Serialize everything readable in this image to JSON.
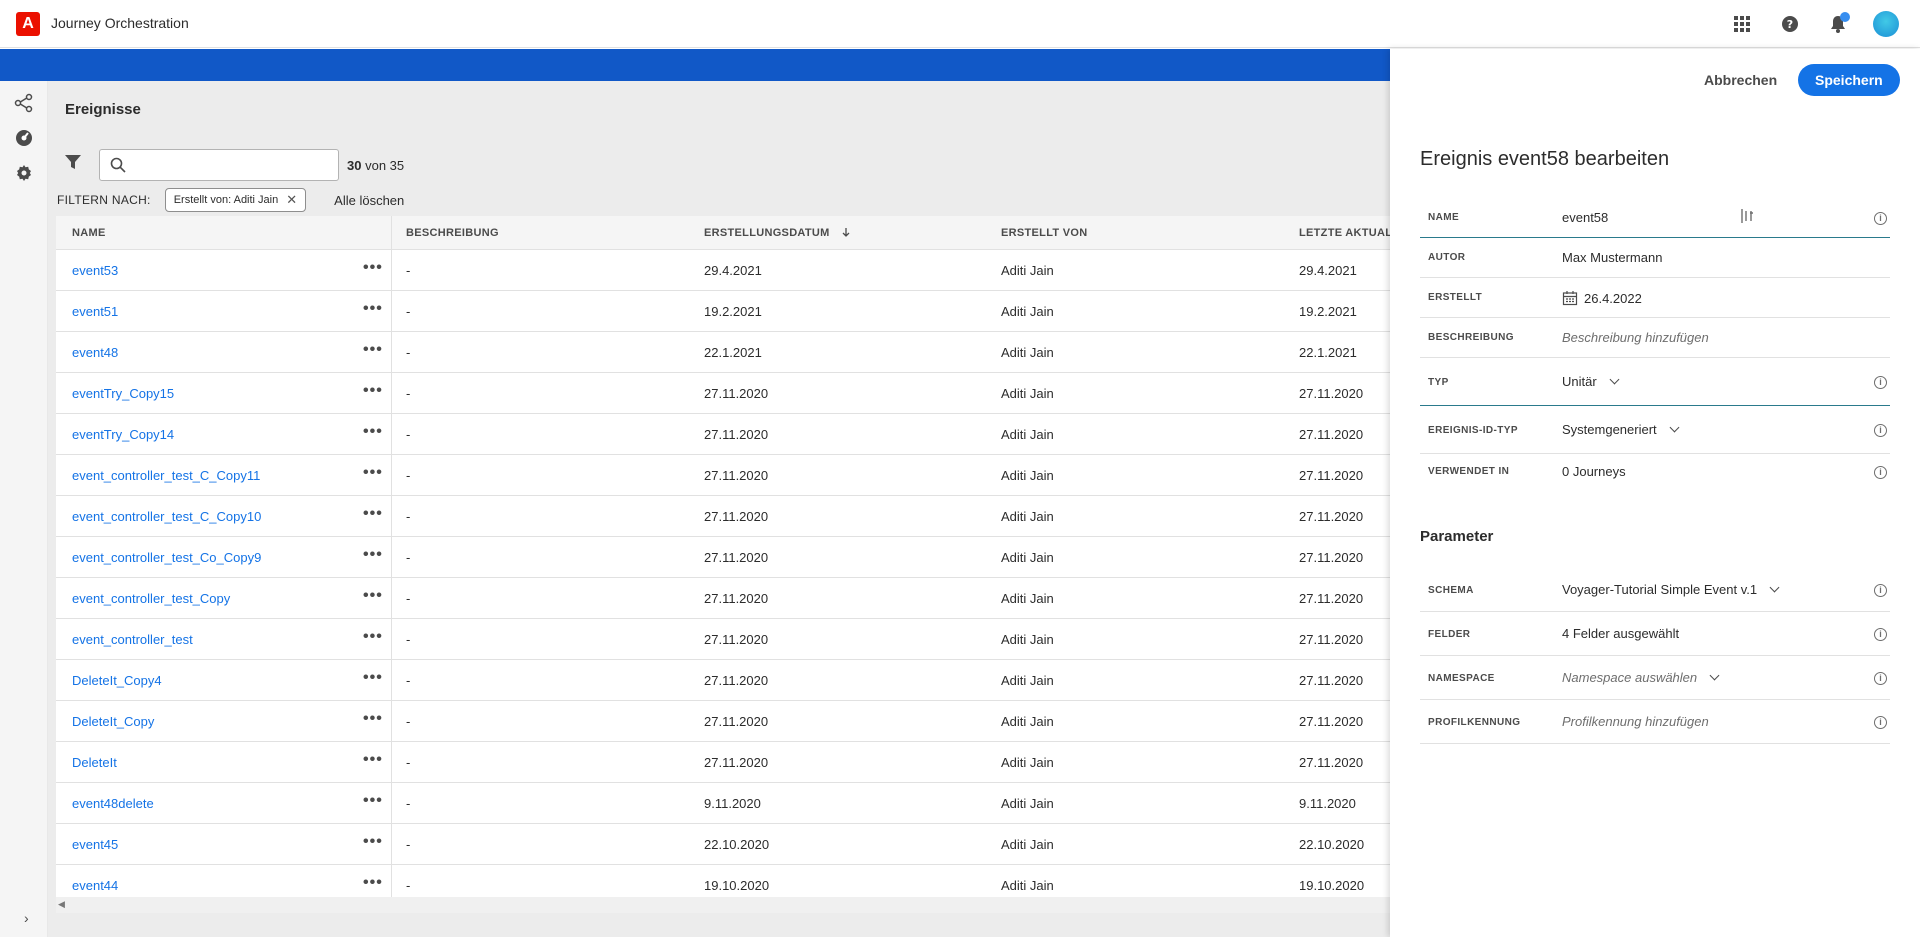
{
  "app": {
    "logo_text": "A",
    "title": "Journey Orchestration"
  },
  "header_icons": [
    "apps-grid-icon",
    "help-icon",
    "notification-bell-icon",
    "user-avatar"
  ],
  "colors": {
    "accent": "#1473e6",
    "band": "#1158c7",
    "brand": "#eb1000"
  },
  "page": {
    "title": "Ereignisse",
    "search": {
      "value": "",
      "placeholder": ""
    },
    "count_shown": "30",
    "count_suffix": "von 35",
    "filter_label": "FILTERN NACH:",
    "filter_chip": "Erstellt von: Aditi Jain",
    "clear_all": "Alle löschen"
  },
  "table": {
    "headers": {
      "name": "NAME",
      "desc": "BESCHREIBUNG",
      "created": "ERSTELLUNGSDATUM",
      "author": "ERSTELLT VON",
      "updated": "LETZTE AKTUALIS"
    },
    "rows": [
      {
        "name": "event53",
        "desc": "-",
        "created": "29.4.2021",
        "author": "Aditi Jain",
        "updated": "29.4.2021"
      },
      {
        "name": "event51",
        "desc": "-",
        "created": "19.2.2021",
        "author": "Aditi Jain",
        "updated": "19.2.2021"
      },
      {
        "name": "event48",
        "desc": "-",
        "created": "22.1.2021",
        "author": "Aditi Jain",
        "updated": "22.1.2021"
      },
      {
        "name": "eventTry_Copy15",
        "desc": "-",
        "created": "27.11.2020",
        "author": "Aditi Jain",
        "updated": "27.11.2020"
      },
      {
        "name": "eventTry_Copy14",
        "desc": "-",
        "created": "27.11.2020",
        "author": "Aditi Jain",
        "updated": "27.11.2020"
      },
      {
        "name": "event_controller_test_C_Copy11",
        "desc": "-",
        "created": "27.11.2020",
        "author": "Aditi Jain",
        "updated": "27.11.2020"
      },
      {
        "name": "event_controller_test_C_Copy10",
        "desc": "-",
        "created": "27.11.2020",
        "author": "Aditi Jain",
        "updated": "27.11.2020"
      },
      {
        "name": "event_controller_test_Co_Copy9",
        "desc": "-",
        "created": "27.11.2020",
        "author": "Aditi Jain",
        "updated": "27.11.2020"
      },
      {
        "name": "event_controller_test_Copy",
        "desc": "-",
        "created": "27.11.2020",
        "author": "Aditi Jain",
        "updated": "27.11.2020"
      },
      {
        "name": "event_controller_test",
        "desc": "-",
        "created": "27.11.2020",
        "author": "Aditi Jain",
        "updated": "27.11.2020"
      },
      {
        "name": "DeleteIt_Copy4",
        "desc": "-",
        "created": "27.11.2020",
        "author": "Aditi Jain",
        "updated": "27.11.2020"
      },
      {
        "name": "DeleteIt_Copy",
        "desc": "-",
        "created": "27.11.2020",
        "author": "Aditi Jain",
        "updated": "27.11.2020"
      },
      {
        "name": "DeleteIt",
        "desc": "-",
        "created": "27.11.2020",
        "author": "Aditi Jain",
        "updated": "27.11.2020"
      },
      {
        "name": "event48delete",
        "desc": "-",
        "created": "9.11.2020",
        "author": "Aditi Jain",
        "updated": "9.11.2020"
      },
      {
        "name": "event45",
        "desc": "-",
        "created": "22.10.2020",
        "author": "Aditi Jain",
        "updated": "22.10.2020"
      },
      {
        "name": "event44",
        "desc": "-",
        "created": "19.10.2020",
        "author": "Aditi Jain",
        "updated": "19.10.2020"
      }
    ]
  },
  "panel": {
    "cancel": "Abbrechen",
    "save": "Speichern",
    "title": "Ereignis event58 bearbeiten",
    "fields": {
      "name_label": "NAME",
      "name_value": "event58",
      "author_label": "AUTOR",
      "author_value": "Max Mustermann",
      "created_label": "ERSTELLT",
      "created_value": "26.4.2022",
      "desc_label": "BESCHREIBUNG",
      "desc_value": "Beschreibung hinzufügen",
      "type_label": "TYP",
      "type_value": "Unitär",
      "idtype_label": "EREIGNIS-ID-TYP",
      "idtype_value": "Systemgeneriert",
      "used_label": "VERWENDET IN",
      "used_value": "0 Journeys"
    },
    "params_title": "Parameter",
    "params": {
      "schema_label": "SCHEMA",
      "schema_value": "Voyager-Tutorial Simple Event v.1",
      "fields_label": "FELDER",
      "fields_value": "4 Felder ausgewählt",
      "namespace_label": "NAMESPACE",
      "namespace_value": "Namespace auswählen",
      "profile_label": "PROFILKENNUNG",
      "profile_value": "Profilkennung hinzufügen"
    }
  }
}
